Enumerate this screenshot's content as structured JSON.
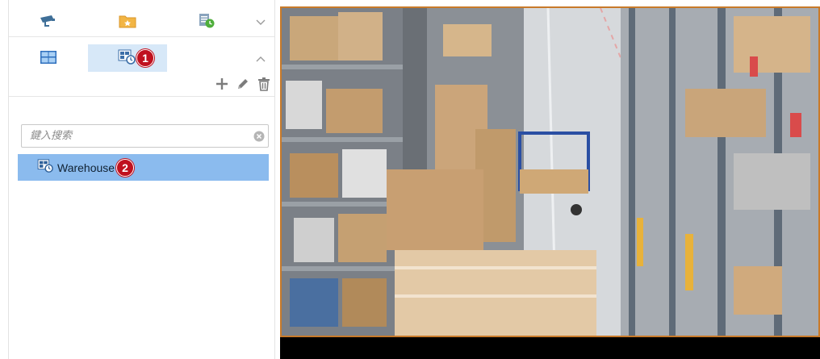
{
  "nav": {
    "row1": [
      {
        "name": "camera-icon"
      },
      {
        "name": "favorites-folder-icon"
      },
      {
        "name": "schedule-icon"
      }
    ],
    "row2": [
      {
        "name": "layout-grid-icon"
      },
      {
        "name": "view-tour-icon",
        "active": true,
        "badge": "1"
      }
    ]
  },
  "toolbar": {
    "add": "add-icon",
    "edit": "edit-icon",
    "delete": "delete-icon"
  },
  "search": {
    "placeholder": "鍵入搜索",
    "value": ""
  },
  "tree": {
    "items": [
      {
        "label": "Warehouse",
        "badge": "2",
        "selected": true
      }
    ]
  },
  "colors": {
    "active_tab": "#d7e8f8",
    "selected_row": "#8bbbee",
    "badge": "#c0111f",
    "video_border": "#c87a2a"
  }
}
